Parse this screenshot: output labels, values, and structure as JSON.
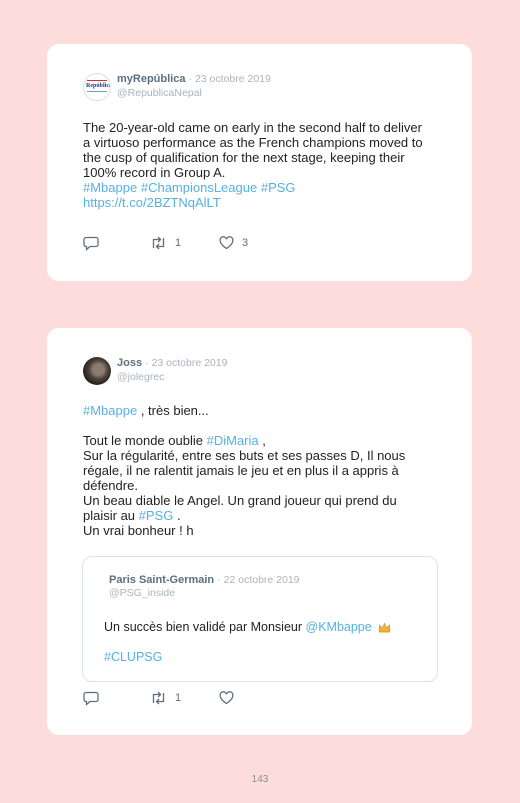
{
  "tweet1": {
    "name": "myRepública",
    "date": "· 23 octobre 2019",
    "handle": "@RepublicaNepal",
    "lines": [
      "The 20-year-old came on early in the second half to deliver",
      "a virtuoso performance as the French champions moved to",
      "the cusp of qualification for the next stage, keeping their",
      "100% record in Group A."
    ],
    "hashtags": [
      "#Mbappe",
      "#ChampionsLeague",
      "#PSG"
    ],
    "url": "https://t.co/2BZTNqAlLT",
    "retweets": "1",
    "likes": "3"
  },
  "tweet2": {
    "name": "Joss",
    "date": "· 23 octobre 2019",
    "handle": "@jolegrec",
    "mention_tag": "#Mbappe",
    "line1_rest": " , très bien...",
    "line2_pre": "Tout le monde oublie ",
    "line2_tag": "#DiMaria",
    "line2_post": " ,",
    "line3": "Sur la régularité, entre ses buts et ses passes D, Il nous",
    "line4": "régale, il ne ralentit jamais le jeu et en plus il a appris à",
    "line5": "défendre.",
    "line6": "Un beau diable le Angel. Un grand joueur qui prend du",
    "line7_pre": "plaisir au ",
    "line7_tag": "#PSG",
    "line7_post": " .",
    "line8": "Un vrai bonheur ! h",
    "retweets": "1",
    "quote": {
      "name": "Paris Saint-Germain",
      "date": "· 22 octobre 2019",
      "handle": "@PSG_inside",
      "text": "Un succès bien validé par Monsieur ",
      "mention": "@KMbappe",
      "hashtag": "#CLUPSG",
      "emoji_icon": "crown-icon"
    }
  },
  "page_number": "143",
  "colors": {
    "background": "#fddcdc",
    "link": "#55b0e4",
    "name": "#5b6f80",
    "muted": "#aab4bd"
  }
}
